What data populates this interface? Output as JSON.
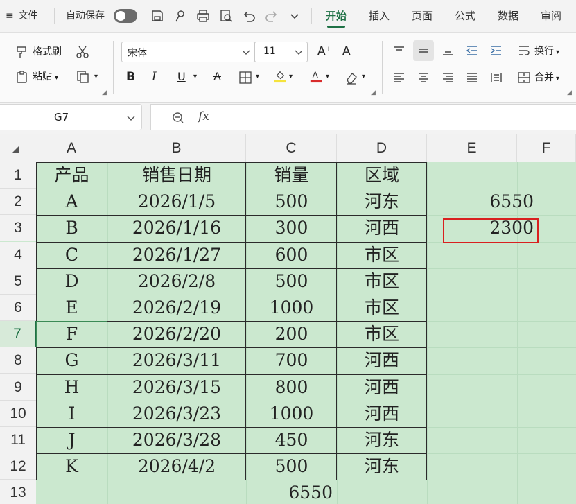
{
  "menubar": {
    "menu_label": "文件",
    "autosave_label": "自动保存",
    "tabs": [
      "开始",
      "插入",
      "页面",
      "公式",
      "数据",
      "审阅"
    ],
    "active_tab": "开始"
  },
  "ribbon": {
    "format_painter": "格式刷",
    "paste": "粘贴",
    "font_name": "宋体",
    "font_size": "11",
    "wrap_text": "换行",
    "merge": "合并"
  },
  "formula_bar": {
    "name_box": "G7",
    "fx": "fx",
    "formula": ""
  },
  "grid": {
    "columns": [
      "A",
      "B",
      "C",
      "D",
      "E",
      "F"
    ],
    "rows": [
      "1",
      "2",
      "3",
      "4",
      "5",
      "6",
      "7",
      "8",
      "9",
      "10",
      "11",
      "12",
      "13"
    ],
    "active_row": "7",
    "cells": [
      [
        "产品",
        "销售日期",
        "销量",
        "区域",
        "",
        ""
      ],
      [
        "A",
        "2026/1/5",
        "500",
        "河东",
        "6550",
        ""
      ],
      [
        "B",
        "2026/1/16",
        "300",
        "河西",
        "2300",
        ""
      ],
      [
        "C",
        "2026/1/27",
        "600",
        "市区",
        "",
        ""
      ],
      [
        "D",
        "2026/2/8",
        "500",
        "市区",
        "",
        ""
      ],
      [
        "E",
        "2026/2/19",
        "1000",
        "市区",
        "",
        ""
      ],
      [
        "F",
        "2026/2/20",
        "200",
        "市区",
        "",
        ""
      ],
      [
        "G",
        "2026/3/11",
        "700",
        "河西",
        "",
        ""
      ],
      [
        "H",
        "2026/3/15",
        "800",
        "河西",
        "",
        ""
      ],
      [
        "I",
        "2026/3/23",
        "1000",
        "河西",
        "",
        ""
      ],
      [
        "J",
        "2026/3/28",
        "450",
        "河东",
        "",
        ""
      ],
      [
        "K",
        "2026/4/2",
        "500",
        "河东",
        "",
        ""
      ],
      [
        "",
        "",
        "6550",
        "",
        "",
        ""
      ]
    ]
  },
  "colors": {
    "accent": "#1e7145",
    "sheet_bg": "#cbe8cf",
    "highlight_border": "#d92020"
  }
}
